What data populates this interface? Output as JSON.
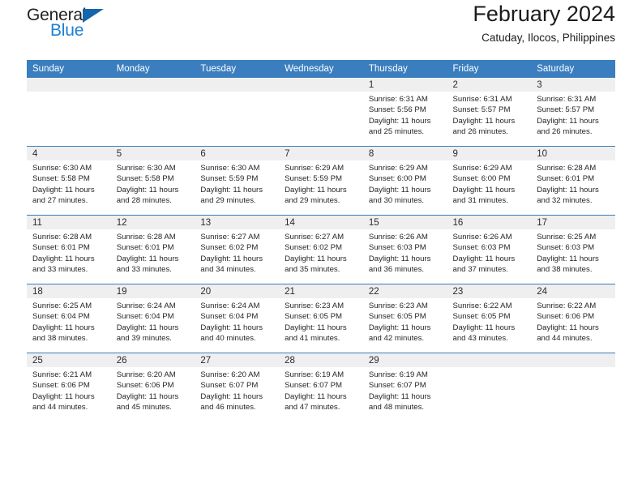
{
  "brand": {
    "name_part1": "General",
    "name_part2": "Blue",
    "triangle_icon": "triangle-logo-icon",
    "colors": {
      "general_text": "#231f20",
      "blue_text": "#1d7fd4",
      "triangle": "#1565ad"
    }
  },
  "header": {
    "title": "February 2024",
    "subtitle": "Catuday, Ilocos, Philippines"
  },
  "theme": {
    "header_row_bg": "#3a7ebf",
    "header_row_text": "#ffffff",
    "daynum_band_bg": "#efefef",
    "cell_bg": "#ffffff",
    "row_divider": "#3a7ebf"
  },
  "weekday_headers": [
    "Sunday",
    "Monday",
    "Tuesday",
    "Wednesday",
    "Thursday",
    "Friday",
    "Saturday"
  ],
  "weeks": [
    [
      {
        "day": "",
        "lines": []
      },
      {
        "day": "",
        "lines": []
      },
      {
        "day": "",
        "lines": []
      },
      {
        "day": "",
        "lines": []
      },
      {
        "day": "1",
        "lines": [
          "Sunrise: 6:31 AM",
          "Sunset: 5:56 PM",
          "Daylight: 11 hours",
          "and 25 minutes."
        ]
      },
      {
        "day": "2",
        "lines": [
          "Sunrise: 6:31 AM",
          "Sunset: 5:57 PM",
          "Daylight: 11 hours",
          "and 26 minutes."
        ]
      },
      {
        "day": "3",
        "lines": [
          "Sunrise: 6:31 AM",
          "Sunset: 5:57 PM",
          "Daylight: 11 hours",
          "and 26 minutes."
        ]
      }
    ],
    [
      {
        "day": "4",
        "lines": [
          "Sunrise: 6:30 AM",
          "Sunset: 5:58 PM",
          "Daylight: 11 hours",
          "and 27 minutes."
        ]
      },
      {
        "day": "5",
        "lines": [
          "Sunrise: 6:30 AM",
          "Sunset: 5:58 PM",
          "Daylight: 11 hours",
          "and 28 minutes."
        ]
      },
      {
        "day": "6",
        "lines": [
          "Sunrise: 6:30 AM",
          "Sunset: 5:59 PM",
          "Daylight: 11 hours",
          "and 29 minutes."
        ]
      },
      {
        "day": "7",
        "lines": [
          "Sunrise: 6:29 AM",
          "Sunset: 5:59 PM",
          "Daylight: 11 hours",
          "and 29 minutes."
        ]
      },
      {
        "day": "8",
        "lines": [
          "Sunrise: 6:29 AM",
          "Sunset: 6:00 PM",
          "Daylight: 11 hours",
          "and 30 minutes."
        ]
      },
      {
        "day": "9",
        "lines": [
          "Sunrise: 6:29 AM",
          "Sunset: 6:00 PM",
          "Daylight: 11 hours",
          "and 31 minutes."
        ]
      },
      {
        "day": "10",
        "lines": [
          "Sunrise: 6:28 AM",
          "Sunset: 6:01 PM",
          "Daylight: 11 hours",
          "and 32 minutes."
        ]
      }
    ],
    [
      {
        "day": "11",
        "lines": [
          "Sunrise: 6:28 AM",
          "Sunset: 6:01 PM",
          "Daylight: 11 hours",
          "and 33 minutes."
        ]
      },
      {
        "day": "12",
        "lines": [
          "Sunrise: 6:28 AM",
          "Sunset: 6:01 PM",
          "Daylight: 11 hours",
          "and 33 minutes."
        ]
      },
      {
        "day": "13",
        "lines": [
          "Sunrise: 6:27 AM",
          "Sunset: 6:02 PM",
          "Daylight: 11 hours",
          "and 34 minutes."
        ]
      },
      {
        "day": "14",
        "lines": [
          "Sunrise: 6:27 AM",
          "Sunset: 6:02 PM",
          "Daylight: 11 hours",
          "and 35 minutes."
        ]
      },
      {
        "day": "15",
        "lines": [
          "Sunrise: 6:26 AM",
          "Sunset: 6:03 PM",
          "Daylight: 11 hours",
          "and 36 minutes."
        ]
      },
      {
        "day": "16",
        "lines": [
          "Sunrise: 6:26 AM",
          "Sunset: 6:03 PM",
          "Daylight: 11 hours",
          "and 37 minutes."
        ]
      },
      {
        "day": "17",
        "lines": [
          "Sunrise: 6:25 AM",
          "Sunset: 6:03 PM",
          "Daylight: 11 hours",
          "and 38 minutes."
        ]
      }
    ],
    [
      {
        "day": "18",
        "lines": [
          "Sunrise: 6:25 AM",
          "Sunset: 6:04 PM",
          "Daylight: 11 hours",
          "and 38 minutes."
        ]
      },
      {
        "day": "19",
        "lines": [
          "Sunrise: 6:24 AM",
          "Sunset: 6:04 PM",
          "Daylight: 11 hours",
          "and 39 minutes."
        ]
      },
      {
        "day": "20",
        "lines": [
          "Sunrise: 6:24 AM",
          "Sunset: 6:04 PM",
          "Daylight: 11 hours",
          "and 40 minutes."
        ]
      },
      {
        "day": "21",
        "lines": [
          "Sunrise: 6:23 AM",
          "Sunset: 6:05 PM",
          "Daylight: 11 hours",
          "and 41 minutes."
        ]
      },
      {
        "day": "22",
        "lines": [
          "Sunrise: 6:23 AM",
          "Sunset: 6:05 PM",
          "Daylight: 11 hours",
          "and 42 minutes."
        ]
      },
      {
        "day": "23",
        "lines": [
          "Sunrise: 6:22 AM",
          "Sunset: 6:05 PM",
          "Daylight: 11 hours",
          "and 43 minutes."
        ]
      },
      {
        "day": "24",
        "lines": [
          "Sunrise: 6:22 AM",
          "Sunset: 6:06 PM",
          "Daylight: 11 hours",
          "and 44 minutes."
        ]
      }
    ],
    [
      {
        "day": "25",
        "lines": [
          "Sunrise: 6:21 AM",
          "Sunset: 6:06 PM",
          "Daylight: 11 hours",
          "and 44 minutes."
        ]
      },
      {
        "day": "26",
        "lines": [
          "Sunrise: 6:20 AM",
          "Sunset: 6:06 PM",
          "Daylight: 11 hours",
          "and 45 minutes."
        ]
      },
      {
        "day": "27",
        "lines": [
          "Sunrise: 6:20 AM",
          "Sunset: 6:07 PM",
          "Daylight: 11 hours",
          "and 46 minutes."
        ]
      },
      {
        "day": "28",
        "lines": [
          "Sunrise: 6:19 AM",
          "Sunset: 6:07 PM",
          "Daylight: 11 hours",
          "and 47 minutes."
        ]
      },
      {
        "day": "29",
        "lines": [
          "Sunrise: 6:19 AM",
          "Sunset: 6:07 PM",
          "Daylight: 11 hours",
          "and 48 minutes."
        ]
      },
      {
        "day": "",
        "lines": []
      },
      {
        "day": "",
        "lines": []
      }
    ]
  ]
}
